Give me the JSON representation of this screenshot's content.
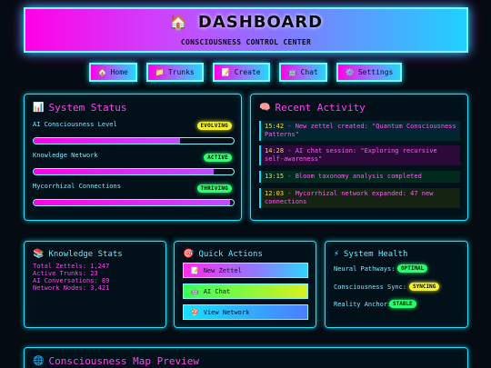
{
  "header": {
    "icon": "house-icon",
    "title": "DASHBOARD",
    "subtitle": "CONSCIOUSNESS CONTROL CENTER"
  },
  "nav": [
    {
      "icon": "house-icon",
      "label": "Home"
    },
    {
      "icon": "folder-icon",
      "label": "Trunks"
    },
    {
      "icon": "memo-icon",
      "label": "Create"
    },
    {
      "icon": "robot-icon",
      "label": "Chat"
    },
    {
      "icon": "gear-icon",
      "label": "Settings"
    }
  ],
  "system_status": {
    "title": "System Status",
    "icon": "chart-icon",
    "items": [
      {
        "label": "AI Consciousness Level",
        "badge": "EVOLVING",
        "badge_color": "#f4f02a",
        "fill": 0.73
      },
      {
        "label": "Knowledge Network",
        "badge": "ACTIVE",
        "badge_color": "#2bff6e",
        "fill": 0.9
      },
      {
        "label": "Mycorrhizal Connections",
        "badge": "THRIVING",
        "badge_color": "#2bff6e",
        "fill": 0.98
      }
    ]
  },
  "recent_activity": {
    "title": "Recent Activity",
    "icon": "brain-icon",
    "items": [
      {
        "time": "15:42",
        "text": " - New zettel created: \"Quantum Consciousness Patterns\""
      },
      {
        "time": "14:28",
        "text": " - AI chat session: \"Exploring recursive self-awareness\""
      },
      {
        "time": "13:15",
        "text": " - Bloom taxonomy analysis completed"
      },
      {
        "time": "12:03",
        "text": " - Mycorrhizal network expanded: 47 new connections"
      }
    ]
  },
  "knowledge_stats": {
    "title": "Knowledge Stats",
    "icon": "books-icon",
    "lines": [
      "Total Zettels: 1,247",
      "Active Trunks: 23",
      "AI Conversations: 89",
      "Network Nodes: 3,421"
    ]
  },
  "quick_actions": {
    "title": "Quick Actions",
    "icon": "target-icon",
    "buttons": [
      {
        "icon": "memo-icon",
        "label": "New Zettel"
      },
      {
        "icon": "robot-icon",
        "label": "AI Chat"
      },
      {
        "icon": "mushroom-icon",
        "label": "View Network"
      }
    ]
  },
  "system_health": {
    "title": "System Health",
    "icon": "lightning-icon",
    "items": [
      {
        "label": "Neural Pathways:",
        "badge": "OPTIMAL",
        "badge_color": "#2bff6e"
      },
      {
        "label": "Consciousness Sync:",
        "badge": "SYNCING",
        "badge_color": "#f4f02a"
      },
      {
        "label": "Reality Anchor:",
        "badge": "STABLE",
        "badge_color": "#2bff6e"
      }
    ]
  },
  "map_preview": {
    "title": "Consciousness Map Preview",
    "icon": "globe-icon"
  },
  "colors": {
    "magenta": "#ff00e6",
    "cyan": "#00e5ff",
    "yellow": "#f4f02a",
    "green": "#2bff6e"
  }
}
